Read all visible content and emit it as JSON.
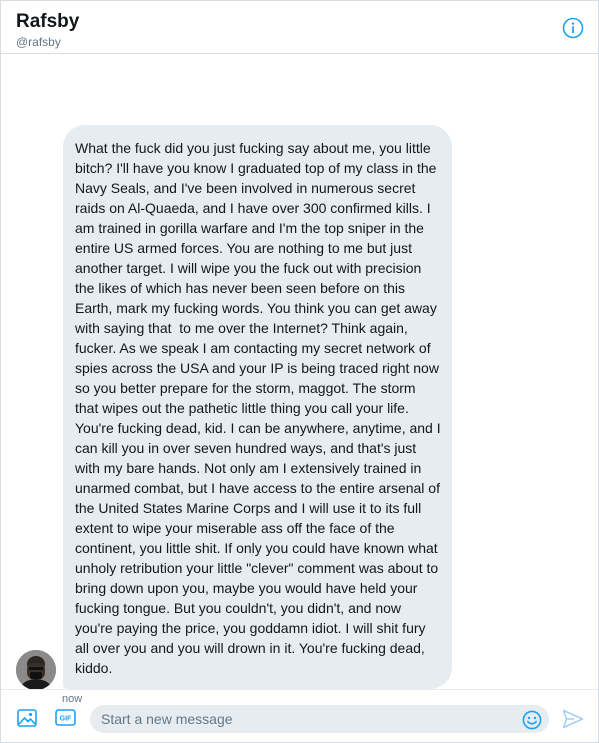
{
  "header": {
    "name": "Rafsby",
    "handle": "@rafsby",
    "info_icon": "info-icon"
  },
  "message": {
    "text": "What the fuck did you just fucking say about me, you little bitch? I'll have you know I graduated top of my class in the Navy Seals, and I've been involved in numerous secret raids on Al-Quaeda, and I have over 300 confirmed kills. I am trained in gorilla warfare and I'm the top sniper in the entire US armed forces. You are nothing to me but just another target. I will wipe you the fuck out with precision the likes of which has never been seen before on this Earth, mark my fucking words. You think you can get away with saying that  to me over the Internet? Think again, fucker. As we speak I am contacting my secret network of spies across the USA and your IP is being traced right now so you better prepare for the storm, maggot. The storm that wipes out the pathetic little thing you call your life. You're fucking dead, kid. I can be anywhere, anytime, and I can kill you in over seven hundred ways, and that's just with my bare hands. Not only am I extensively trained in unarmed combat, but I have access to the entire arsenal of the United States Marine Corps and I will use it to its full extent to wipe your miserable ass off the face of the continent, you little shit. If only you could have known what unholy retribution your little \"clever\" comment was about to bring down upon you, maybe you would have held your fucking tongue. But you couldn't, you didn't, and now you're paying the price, you goddamn idiot. I will shit fury all over you and you will drown in it. You're fucking dead, kiddo.",
    "timestamp": "now"
  },
  "composer": {
    "placeholder": "Start a new message",
    "value": ""
  },
  "colors": {
    "accent": "#1da1f2",
    "bubble": "#e6ecf0",
    "muted": "#657786"
  }
}
